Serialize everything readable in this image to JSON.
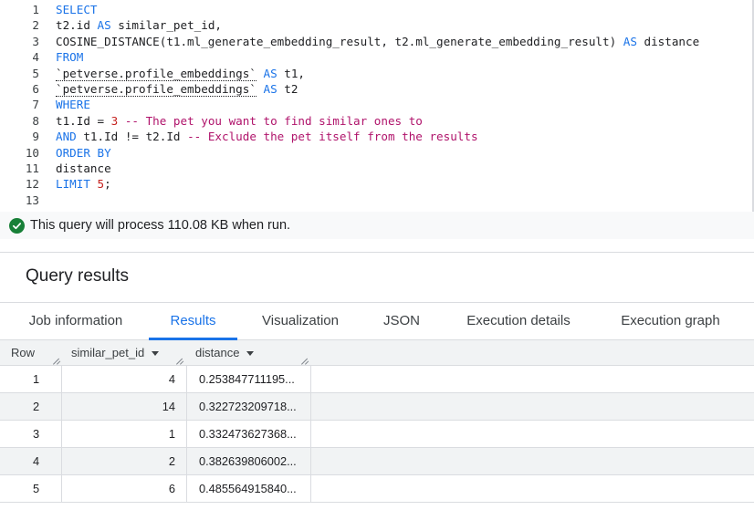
{
  "editor": {
    "lines": [
      {
        "n": "1",
        "parts": [
          {
            "t": "SELECT",
            "c": "kw"
          }
        ]
      },
      {
        "n": "2",
        "parts": [
          {
            "t": "t2.id ",
            "c": "txt"
          },
          {
            "t": "AS",
            "c": "kw"
          },
          {
            "t": " similar_pet_id,",
            "c": "txt"
          }
        ]
      },
      {
        "n": "3",
        "parts": [
          {
            "t": "COSINE_DISTANCE(t1.ml_generate_embedding_result, t2.ml_generate_embedding_result) ",
            "c": "txt"
          },
          {
            "t": "AS",
            "c": "kw"
          },
          {
            "t": " distance",
            "c": "txt"
          }
        ]
      },
      {
        "n": "4",
        "parts": [
          {
            "t": "FROM",
            "c": "kw"
          }
        ]
      },
      {
        "n": "5",
        "parts": [
          {
            "t": "`petverse.profile_embeddings`",
            "c": "tbl"
          },
          {
            "t": " ",
            "c": "txt"
          },
          {
            "t": "AS",
            "c": "kw"
          },
          {
            "t": " t1,",
            "c": "txt"
          }
        ]
      },
      {
        "n": "6",
        "parts": [
          {
            "t": "`petverse.profile_embeddings`",
            "c": "tbl"
          },
          {
            "t": " ",
            "c": "txt"
          },
          {
            "t": "AS",
            "c": "kw"
          },
          {
            "t": " t2",
            "c": "txt"
          }
        ]
      },
      {
        "n": "7",
        "parts": [
          {
            "t": "WHERE",
            "c": "kw"
          }
        ]
      },
      {
        "n": "8",
        "parts": [
          {
            "t": "t1.Id = ",
            "c": "txt"
          },
          {
            "t": "3",
            "c": "num"
          },
          {
            "t": " -- The pet you want to find similar ones to",
            "c": "cmt"
          }
        ]
      },
      {
        "n": "9",
        "parts": [
          {
            "t": "AND",
            "c": "kw"
          },
          {
            "t": " t1.Id != t2.Id ",
            "c": "txt"
          },
          {
            "t": "-- Exclude the pet itself from the results",
            "c": "cmt"
          }
        ]
      },
      {
        "n": "10",
        "parts": [
          {
            "t": "ORDER BY",
            "c": "kw"
          }
        ]
      },
      {
        "n": "11",
        "parts": [
          {
            "t": "distance",
            "c": "txt"
          }
        ]
      },
      {
        "n": "12",
        "parts": [
          {
            "t": "LIMIT",
            "c": "kw"
          },
          {
            "t": " ",
            "c": "txt"
          },
          {
            "t": "5",
            "c": "num"
          },
          {
            "t": ";",
            "c": "txt"
          }
        ]
      },
      {
        "n": "13",
        "parts": []
      }
    ]
  },
  "validation": {
    "message": "This query will process 110.08 KB when run.",
    "icon": "check-circle-icon",
    "color": "#188038"
  },
  "results": {
    "title": "Query results",
    "tabs": [
      {
        "label": "Job information",
        "active": false
      },
      {
        "label": "Results",
        "active": true
      },
      {
        "label": "Visualization",
        "active": false
      },
      {
        "label": "JSON",
        "active": false
      },
      {
        "label": "Execution details",
        "active": false
      },
      {
        "label": "Execution graph",
        "active": false
      }
    ],
    "columns": {
      "row": "Row",
      "similar_pet_id": "similar_pet_id",
      "distance": "distance"
    },
    "rows": [
      {
        "row": "1",
        "similar_pet_id": "4",
        "distance": "0.253847711195..."
      },
      {
        "row": "2",
        "similar_pet_id": "14",
        "distance": "0.322723209718..."
      },
      {
        "row": "3",
        "similar_pet_id": "1",
        "distance": "0.332473627368..."
      },
      {
        "row": "4",
        "similar_pet_id": "2",
        "distance": "0.382639806002..."
      },
      {
        "row": "5",
        "similar_pet_id": "6",
        "distance": "0.485564915840..."
      }
    ]
  },
  "colors": {
    "accent": "#1a73e8",
    "keyword": "#1a73e8",
    "number": "#c5221f",
    "comment": "#b0136b"
  }
}
